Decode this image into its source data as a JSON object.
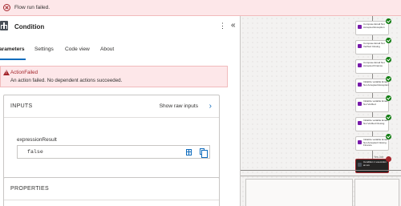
{
  "banner": {
    "message": "Flow run failed.",
    "icon": "error-circle-icon"
  },
  "panel": {
    "title": "Condition",
    "more_label": "⋮",
    "collapse_label": "«",
    "tabs": [
      {
        "label": "arameters",
        "active": true
      },
      {
        "label": "Settings",
        "active": false
      },
      {
        "label": "Code view",
        "active": false
      },
      {
        "label": "About",
        "active": false
      }
    ],
    "error": {
      "title": "ActionFailed",
      "message": "An action failed. No dependent actions succeeded."
    },
    "inputs": {
      "header": "INPUTS",
      "show_raw": "Show raw inputs",
      "chevron": "›",
      "field_label": "expressionResult",
      "field_value": "false"
    },
    "properties": {
      "header": "PROPERTIES"
    }
  },
  "canvas": {
    "nodes": [
      {
        "text": "Compose Email Not Accepted Exception",
        "status": "succeeded"
      },
      {
        "text": "Compose Email Not Verified Closing",
        "status": "succeeded"
      },
      {
        "text": "Compose Email Not Accepted Finance",
        "status": "succeeded"
      },
      {
        "text": "Initialize variable Email Not Accepted Exception",
        "status": "succeeded"
      },
      {
        "text": "Initialize variable Email Not Verified",
        "status": "succeeded"
      },
      {
        "text": "Initialize variable Email Not Verified Closing",
        "status": "succeeded"
      },
      {
        "text": "Initialize variable Email Not Accepted Closing Finance",
        "status": "succeeded"
      }
    ],
    "yes_label": "Yes Job",
    "failed_node": {
      "text": "Condition 1 execution at xxx",
      "status": "failed"
    },
    "colors": {
      "succeeded": "#107c10",
      "failed": "#a4262c",
      "accent": "#0f6cbd"
    }
  }
}
